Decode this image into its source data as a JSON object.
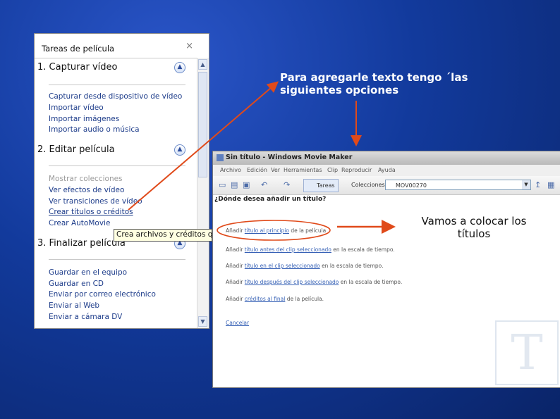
{
  "task_pane": {
    "title": "Tareas de película",
    "close_glyph": "×",
    "sections": [
      {
        "title": "1. Capturar vídeo",
        "items": [
          {
            "label": "Capturar desde dispositivo de vídeo"
          },
          {
            "label": "Importar vídeo"
          },
          {
            "label": "Importar imágenes"
          },
          {
            "label": "Importar audio o música"
          }
        ]
      },
      {
        "title": "2. Editar película",
        "items": [
          {
            "label": "Mostrar colecciones"
          },
          {
            "label": "Ver efectos de vídeo"
          },
          {
            "label": "Ver transiciones de vídeo"
          },
          {
            "label": "Crear títulos o créditos"
          },
          {
            "label": "Crear AutoMovie"
          }
        ]
      },
      {
        "title": "3. Finalizar película",
        "items": [
          {
            "label": "Guardar en el equipo"
          },
          {
            "label": "Guardar en CD"
          },
          {
            "label": "Enviar por correo electrónico"
          },
          {
            "label": "Enviar al Web"
          },
          {
            "label": "Enviar a cámara DV"
          }
        ]
      }
    ],
    "tooltip": "Crea archivos y créditos que"
  },
  "notes": {
    "options": "Para agregarle texto tengo ´las siguientes opciones",
    "titles": "Vamos a colocar los títulos"
  },
  "movie_maker": {
    "window_title": "Sin título - Windows Movie Maker",
    "menu": [
      "Archivo",
      "Edición",
      "Ver",
      "Herramientas",
      "Clip",
      "Reproducir",
      "Ayuda"
    ],
    "toolbar": {
      "tasks_label": "Tareas",
      "collections_label": "Colecciones",
      "collection_value": "MOV00270"
    },
    "heading": "¿Dónde desea añadir un título?",
    "options": [
      {
        "pre": "Añadir ",
        "link": "título al principio",
        "post": " de la película"
      },
      {
        "pre": "Añadir ",
        "link": "título antes del clip seleccionado",
        "post": " en la escala de tiempo."
      },
      {
        "pre": "Añadir ",
        "link": "título en el clip seleccionado",
        "post": " en la escala de tiempo."
      },
      {
        "pre": "Añadir ",
        "link": "título después del clip seleccionado",
        "post": " en la escala de tiempo."
      },
      {
        "pre": "Añadir ",
        "link": "créditos al final",
        "post": " de la película."
      }
    ],
    "cancel": "Cancelar",
    "watermark_letter": "T"
  },
  "colors": {
    "background": "#123a9c",
    "arrow": "#e04a1a",
    "link": "#1d3c8a"
  }
}
